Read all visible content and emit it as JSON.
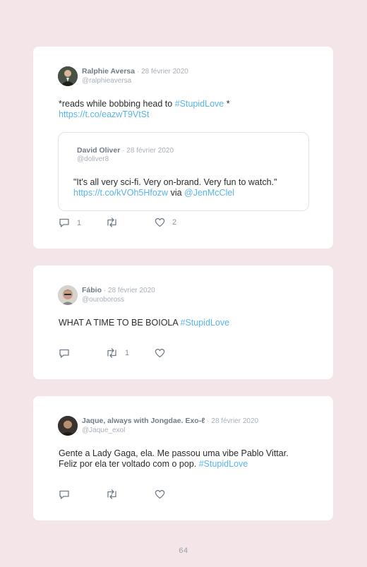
{
  "tweets": [
    {
      "name": "Ralphie Aversa",
      "date": "· 28 février 2020",
      "handle": "@ralphieaversa",
      "text_line1": "*reads while bobbing head to ",
      "hashtag": "#StupidLove",
      "text_line1_end": " *",
      "link": "https://t.co/eazwT9VtSt",
      "quote": {
        "name": "David Oliver",
        "date": "· 28 février 2020",
        "handle": "@doliver8",
        "text": "\"It's all very sci-fi. Very on-brand. Very fun to watch.\"",
        "link": "https://t.co/kVOh5Hfozw",
        "via": " via ",
        "mention": "@JenMcClel"
      },
      "reply_count": "1",
      "retweet_count": "",
      "like_count": "2"
    },
    {
      "name": "Fábio",
      "date": "· 28 février 2020",
      "handle": "@ouroboross",
      "text": "WHAT A TIME TO BE BOIOLA ",
      "hashtag": "#StupidLove",
      "reply_count": "",
      "retweet_count": "1",
      "like_count": ""
    },
    {
      "name": "Jaque, always with Jongdae. Exo-ℓ",
      "date": "· 28 février 2020",
      "handle": "@Jaque_exol",
      "text_line1": "Gente a Lady Gaga, ela. Me passou uma vibe Pablo Vittar.",
      "text_line2": "Feliz por ela ter voltado com o pop. ",
      "hashtag": "#StupidLove",
      "reply_count": "",
      "retweet_count": "",
      "like_count": ""
    }
  ],
  "page_number": "64",
  "icons": {
    "reply": "reply-icon",
    "retweet": "retweet-icon",
    "like": "heart-icon"
  },
  "colors": {
    "background": "#f4e6e8",
    "link": "#58b4e8",
    "card": "#ffffff"
  }
}
